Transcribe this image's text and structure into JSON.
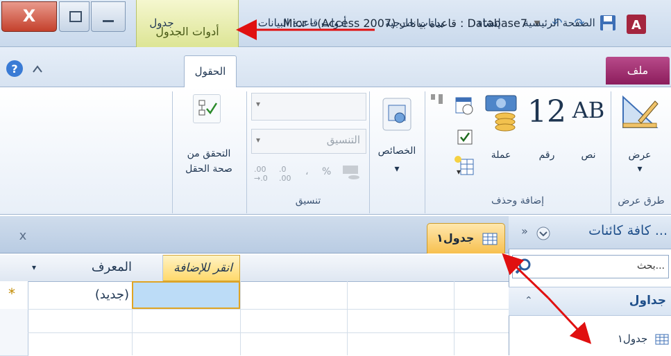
{
  "window": {
    "title": "Micr - (Access 2007) قاعدة بيانات : Database7",
    "contextual_tab": "أدوات الجدول",
    "close_glyph": "X"
  },
  "tabs": {
    "file": "ملف",
    "home": "الصفحة الرئيسية",
    "create": "إنشاء",
    "external": "بيانات خارجية",
    "dbtools": "أدوات قاعدة البيانات",
    "fields": "الحقول",
    "table": "جدول"
  },
  "ribbon": {
    "views": {
      "group": "طرق عرض",
      "view_button": "عرض"
    },
    "add_delete": {
      "group": "إضافة وحذف",
      "text_label": "نص",
      "text_glyph": "AB",
      "number_label": "رقم",
      "number_glyph": "12",
      "currency_label": "عملة"
    },
    "properties": {
      "label": "الخصائص"
    },
    "formatting": {
      "group": "تنسيق",
      "format_placeholder": "التنسيق",
      "percent": "%",
      "comma": "،",
      "inc_decimals": "←,0 .00",
      "dec_decimals": ",00 →.0"
    },
    "validation": {
      "label_line1": "التحقق من",
      "label_line2": "صحة الحقل"
    }
  },
  "nav": {
    "title": "كافة كائنات ...",
    "search_placeholder": "بحث...",
    "section": "جداول",
    "item": "جدول١",
    "chevrons": "»"
  },
  "document": {
    "tab": "جدول١",
    "close": "x",
    "col_add": "انقر للإضافة",
    "col_id": "المعرف",
    "new_row_marker": "*",
    "new_value": "(جديد)"
  },
  "colors": {
    "file_tab": "#a43376",
    "contextual": "#d9e28c",
    "arrow": "#e01010"
  }
}
